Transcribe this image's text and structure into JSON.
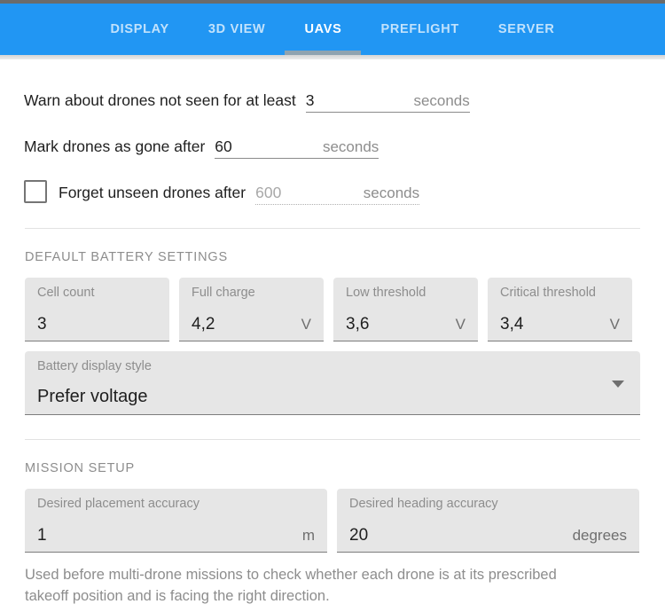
{
  "window": {
    "title": "UAVs"
  },
  "tabs": [
    {
      "id": "display",
      "label": "DISPLAY",
      "active": false
    },
    {
      "id": "3d-view",
      "label": "3D VIEW",
      "active": false
    },
    {
      "id": "uavs",
      "label": "UAVS",
      "active": true
    },
    {
      "id": "preflight",
      "label": "PREFLIGHT",
      "active": false
    },
    {
      "id": "server",
      "label": "SERVER",
      "active": false
    }
  ],
  "timeouts": {
    "warn": {
      "label": "Warn about drones not seen for at least",
      "value": "3",
      "unit": "seconds",
      "enabled": true,
      "has_checkbox": false
    },
    "gone": {
      "label": "Mark drones as gone after",
      "value": "60",
      "unit": "seconds",
      "enabled": true,
      "has_checkbox": false
    },
    "forget": {
      "label": "Forget unseen drones after",
      "value": "600",
      "unit": "seconds",
      "enabled": false,
      "has_checkbox": true,
      "checked": false
    }
  },
  "battery": {
    "section_title": "Default battery settings",
    "fields": [
      {
        "id": "cell-count",
        "label": "Cell count",
        "value": "3",
        "unit": ""
      },
      {
        "id": "full-charge",
        "label": "Full charge",
        "value": "4,2",
        "unit": "V"
      },
      {
        "id": "low-threshold",
        "label": "Low threshold",
        "value": "3,6",
        "unit": "V"
      },
      {
        "id": "critical-threshold",
        "label": "Critical threshold",
        "value": "3,4",
        "unit": "V"
      }
    ],
    "display_style": {
      "label": "Battery display style",
      "value": "Prefer voltage"
    }
  },
  "mission": {
    "section_title": "Mission setup",
    "fields": [
      {
        "id": "placement-accuracy",
        "label": "Desired placement accuracy",
        "value": "1",
        "unit": "m"
      },
      {
        "id": "heading-accuracy",
        "label": "Desired heading accuracy",
        "value": "20",
        "unit": "degrees"
      }
    ],
    "helper": "Used before multi-drone missions to check whether each drone is at its prescribed takeoff position and is facing the right direction."
  },
  "colors": {
    "accent": "#2196f3",
    "active_tab_underline": "#8fa3b0",
    "field_bg": "#e6e6e6",
    "muted_text": "#8d8d8d",
    "text": "#1f1f1f"
  }
}
